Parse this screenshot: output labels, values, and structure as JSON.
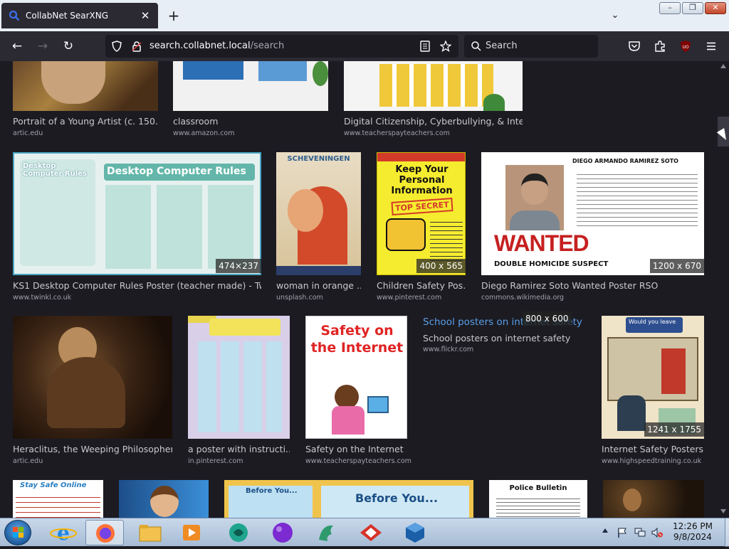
{
  "browser": {
    "tab_title": "CollabNet SearXNG",
    "url_host": "search.collabnet.local",
    "url_path": "/search",
    "search_placeholder": "Search"
  },
  "results": [
    {
      "title": "Portrait of a Young Artist (c. 150...",
      "url": "artic.edu",
      "dims": ""
    },
    {
      "title": "classroom",
      "url": "www.amazon.com",
      "dims": ""
    },
    {
      "title": "Digital Citizenship, Cyberbullying, & Inter...",
      "url": "www.teacherspayteachers.com",
      "dims": ""
    },
    {
      "title": "KS1 Desktop Computer Rules Poster (teacher made) - Twi...",
      "url": "www.twinkl.co.uk",
      "dims": "474×237",
      "thumb_text": "Desktop Computer Rules"
    },
    {
      "title": "woman in orange ...",
      "url": "unsplash.com",
      "dims": "",
      "thumb_text": "SCHEVENINGEN"
    },
    {
      "title": "Children Safety Pos...",
      "url": "www.pinterest.com",
      "dims": "400 x 565",
      "thumb_text": "Keep Your Personal Information",
      "thumb_sub": "TOP SECRET"
    },
    {
      "title": "Diego Ramirez Soto Wanted Poster RSO",
      "url": "commons.wikimedia.org",
      "dims": "1200 x 670",
      "thumb_text": "DIEGO ARMANDO RAMIREZ SOTO",
      "thumb_sub": "WANTED",
      "thumb_sub2": "DOUBLE HOMICIDE SUSPECT"
    },
    {
      "title": "Heraclitus, the Weeping Philosopher...",
      "url": "artic.edu",
      "dims": ""
    },
    {
      "title": "a poster with instructi...",
      "url": "in.pinterest.com",
      "dims": ""
    },
    {
      "title": "Safety on the Internet ...",
      "url": "www.teacherspayteachers.com",
      "dims": "",
      "thumb_text": "Safety on the Internet"
    },
    {
      "title": "School posters on internet safety",
      "url": "www.flickr.com",
      "dims": "800 x 600",
      "link_text": "School posters on internet safety"
    },
    {
      "title": "Internet Safety Posters...",
      "url": "www.highspeedtraining.co.uk",
      "dims": "1241 x 1755",
      "thumb_text": "Would you leave"
    },
    {
      "title": "",
      "url": "",
      "dims": "",
      "thumb_text": "Stay Safe Online"
    },
    {
      "title": "",
      "url": "",
      "dims": ""
    },
    {
      "title": "",
      "url": "",
      "dims": "",
      "thumb_text": "Before You..."
    },
    {
      "title": "",
      "url": "",
      "dims": "",
      "thumb_text": "Police Bulletin"
    },
    {
      "title": "",
      "url": "",
      "dims": ""
    }
  ],
  "taskbar": {
    "apps": [
      "start-button",
      "internet-explorer-icon",
      "firefox-icon",
      "file-explorer-icon",
      "media-player-icon",
      "app-green-icon",
      "app-purple-icon",
      "app-dragon-icon",
      "app-red-icon",
      "virtualbox-icon"
    ],
    "time": "12:26 PM",
    "date": "9/8/2024"
  },
  "colors": {
    "background": "#1c1b22",
    "toolbar": "#2b2a33",
    "link": "#5a9fe8"
  }
}
